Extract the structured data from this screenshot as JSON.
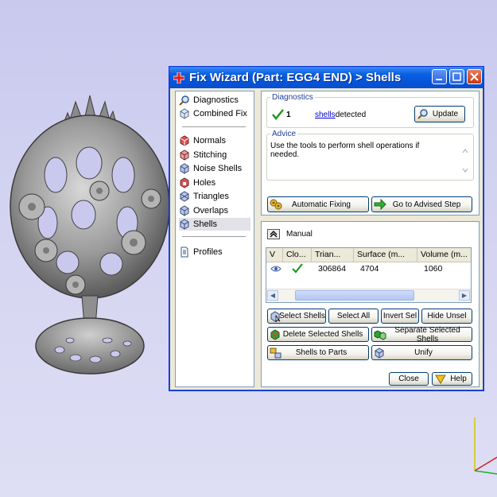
{
  "window": {
    "title": "Fix Wizard (Part: EGG4 END) > Shells"
  },
  "nav": {
    "items": [
      {
        "label": "Diagnostics",
        "icon": "magnifier-icon"
      },
      {
        "label": "Combined Fix",
        "icon": "cube-icon"
      },
      {
        "label": "Normals",
        "icon": "normals-icon"
      },
      {
        "label": "Stitching",
        "icon": "stitching-icon"
      },
      {
        "label": "Noise Shells",
        "icon": "noise-shells-icon"
      },
      {
        "label": "Holes",
        "icon": "holes-icon"
      },
      {
        "label": "Triangles",
        "icon": "triangles-icon"
      },
      {
        "label": "Overlaps",
        "icon": "overlaps-icon"
      },
      {
        "label": "Shells",
        "icon": "shells-icon"
      },
      {
        "label": "Profiles",
        "icon": "document-icon"
      }
    ],
    "selected": "Shells"
  },
  "diagnostics": {
    "legend": "Diagnostics",
    "count": "1",
    "link": "shells",
    "suffix": " detected",
    "update_label": "Update"
  },
  "advice": {
    "legend": "Advice",
    "text": "Use the tools to perform shell operations if needed."
  },
  "actions": {
    "automatic_fixing": "Automatic Fixing",
    "go_advised": "Go to Advised Step"
  },
  "manual": {
    "label": "Manual",
    "columns": [
      "V",
      "Clo...",
      "Trian...",
      "Surface (m...",
      "Volume (m..."
    ],
    "rows": [
      {
        "triangles": "306864",
        "surface": "4704",
        "volume": "1060"
      }
    ]
  },
  "buttons": {
    "select_shells": "Select Shells",
    "select_all": "Select All",
    "invert_sel": "Invert Sel",
    "hide_unsel": "Hide Unsel",
    "delete_selected": "Delete Selected Shells",
    "separate_selected": "Separate Selected Shells",
    "shells_to_parts": "Shells to Parts",
    "unify": "Unify",
    "close": "Close",
    "help": "Help"
  },
  "colors": {
    "titlebar": "#0654d8",
    "check": "#1f9a1f",
    "link": "#0000cc"
  }
}
